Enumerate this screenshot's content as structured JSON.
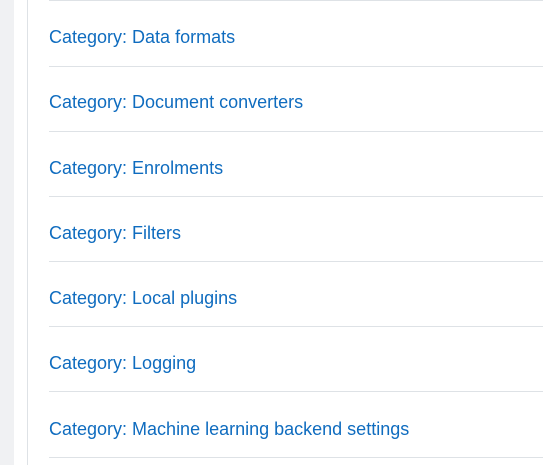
{
  "categories": {
    "prefix": "Category:",
    "items": [
      "Data formats",
      "Document converters",
      "Enrolments",
      "Filters",
      "Local plugins",
      "Logging",
      "Machine learning backend settings"
    ]
  },
  "colors": {
    "link": "#0f6cbf",
    "divider": "#dee2e6",
    "gutter": "#f0f1f3"
  }
}
